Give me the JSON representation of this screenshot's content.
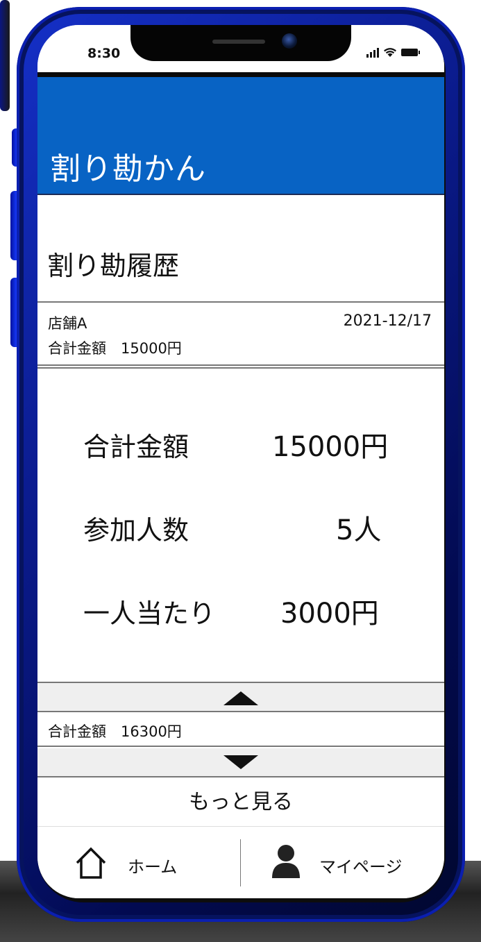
{
  "status_bar": {
    "time": "8:30"
  },
  "app": {
    "title": "割り勘かん"
  },
  "section": {
    "title": "割り勘履歴"
  },
  "history": [
    {
      "store": "店舗A",
      "date": "2021-12/17",
      "total_text": "合計金額　15000円"
    },
    {
      "total_text": "合計金額　16300円"
    }
  ],
  "detail": {
    "total_label": "合計金額",
    "total_value": "15000円",
    "people_label": "参加人数",
    "people_value": "5人",
    "per_person_label": "一人当たり",
    "per_person_value": "3000円"
  },
  "more_button": "もっと見る",
  "nav": {
    "home_label": "ホーム",
    "mypage_label": "マイページ"
  },
  "colors": {
    "header_blue": "#0863c4",
    "phone_frame": "#0a1a8a"
  },
  "icons": [
    "camera-icon",
    "signal-icon",
    "wifi-icon",
    "battery-icon",
    "collapse-arrow-icon",
    "expand-arrow-icon",
    "home-icon",
    "person-icon"
  ]
}
